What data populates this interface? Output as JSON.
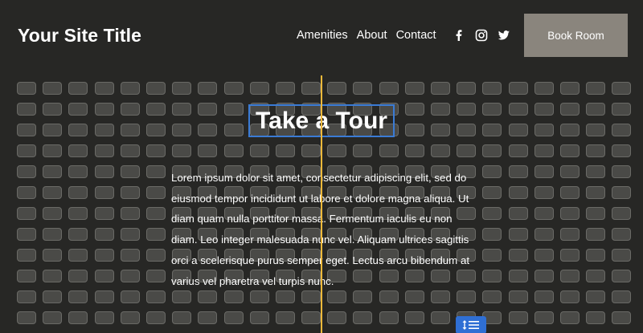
{
  "header": {
    "site_title": "Your Site Title",
    "nav": [
      "Amenities",
      "About",
      "Contact"
    ],
    "social_icons": [
      "facebook-icon",
      "instagram-icon",
      "twitter-icon"
    ],
    "book_button": "Book Room"
  },
  "main": {
    "title": "Take a Tour",
    "body": "Lorem ipsum dolor sit amet, consectetur adipiscing elit, sed do eiusmod tempor incididunt ut labore et dolore magna aliqua. Ut diam quam nulla porttitor massa. Fermentum iaculis eu non diam. Leo integer malesuada nunc vel. Aliquam ultrices sagittis orci a scelerisque purus semper eget. Lectus arcu bibendum at varius vel pharetra vel turpis nunc."
  },
  "editor": {
    "grid_overlay": true,
    "guide_color": "#f0b93a",
    "selection_color": "#3a7bd5",
    "spacing_handle_icon": "line-height-icon"
  }
}
